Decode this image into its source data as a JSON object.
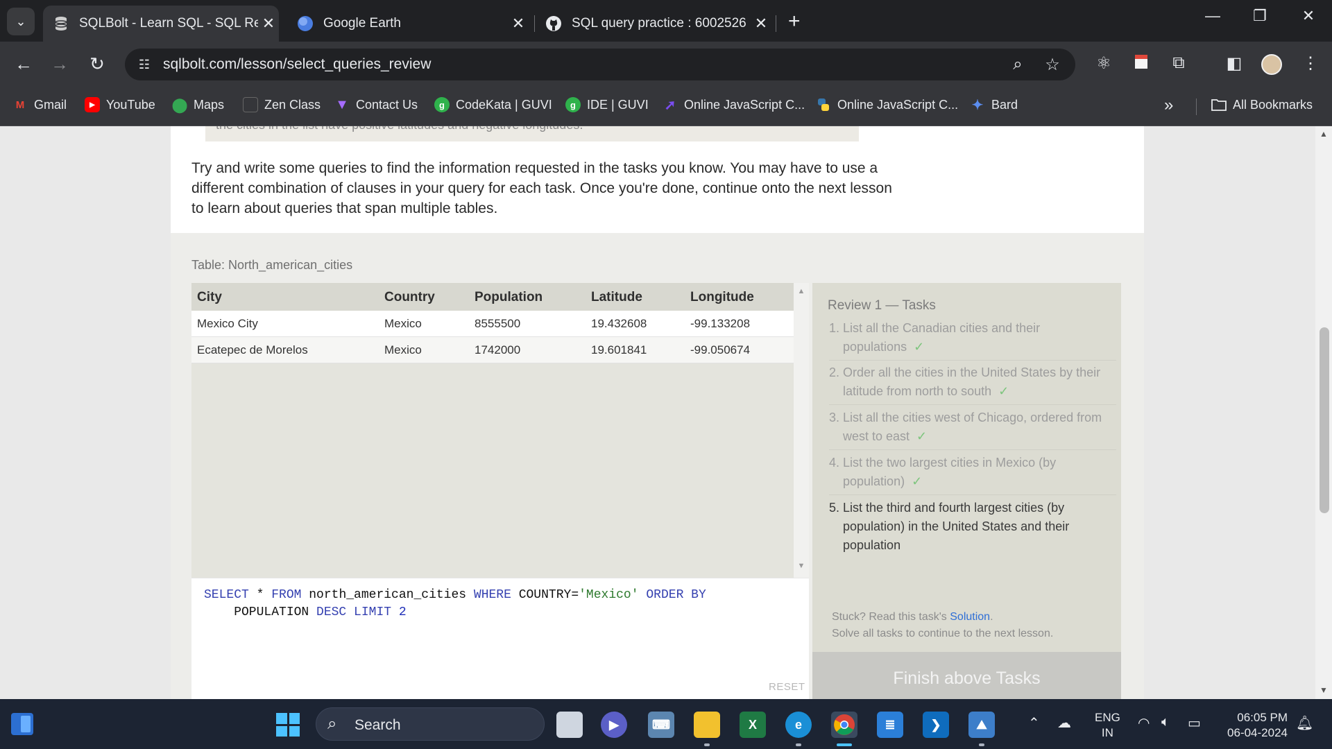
{
  "tabs": [
    {
      "title": "SQLBolt - Learn SQL - SQL Revi",
      "active": true
    },
    {
      "title": "Google Earth",
      "active": false
    },
    {
      "title": "SQL query practice : 6002526",
      "active": false
    }
  ],
  "url": "sqlbolt.com/lesson/select_queries_review",
  "bookmarks": [
    {
      "label": "Gmail",
      "icon": "gmail-icon"
    },
    {
      "label": "YouTube",
      "icon": "youtube-icon"
    },
    {
      "label": "Maps",
      "icon": "maps-icon"
    },
    {
      "label": "Zen Class",
      "icon": "zen-class-icon"
    },
    {
      "label": "Contact Us",
      "icon": "vite-icon"
    },
    {
      "label": "CodeKata | GUVI",
      "icon": "guvi-icon"
    },
    {
      "label": "IDE | GUVI",
      "icon": "guvi-icon"
    },
    {
      "label": "Online JavaScript C...",
      "icon": "js-compiler-icon"
    },
    {
      "label": "Online JavaScript C...",
      "icon": "python-icon"
    },
    {
      "label": "Bard",
      "icon": "bard-icon"
    }
  ],
  "all_bookmarks": "All Bookmarks",
  "lesson": {
    "hidden_line": "the cities in the list have positive latitudes and negative longitudes.",
    "intro": "Try and write some queries to find the information requested in the tasks you know. You may have to use a different combination of clauses in your query for each task. Once you're done, continue onto the next lesson to learn about queries that span multiple tables.",
    "table_caption": "Table: North_american_cities",
    "columns": [
      "City",
      "Country",
      "Population",
      "Latitude",
      "Longitude"
    ],
    "rows": [
      [
        "Mexico City",
        "Mexico",
        "8555500",
        "19.432608",
        "-99.133208"
      ],
      [
        "Ecatepec de Morelos",
        "Mexico",
        "1742000",
        "19.601841",
        "-99.050674"
      ]
    ],
    "query_line1": "SELECT * FROM north_american_cities WHERE COUNTRY='Mexico' ORDER BY",
    "query_line2": "    POPULATION DESC LIMIT 2",
    "reset": "RESET"
  },
  "tasks": {
    "title": "Review 1 — Tasks",
    "items": [
      {
        "num": "1.",
        "text": "List all the Canadian cities and their populations",
        "done": true
      },
      {
        "num": "2.",
        "text": "Order all the cities in the United States by their latitude from north to south",
        "done": true
      },
      {
        "num": "3.",
        "text": "List all the cities west of Chicago, ordered from west to east",
        "done": true
      },
      {
        "num": "4.",
        "text": "List the two largest cities in Mexico (by population)",
        "done": true
      },
      {
        "num": "5.",
        "text": "List the third and fourth largest cities (by population) in the United States and their population",
        "done": false
      }
    ],
    "check": "✓",
    "stuck_prefix": "Stuck? Read this task's ",
    "solution_link": "Solution",
    "stuck_suffix": ".",
    "solve_all": "Solve all tasks to continue to the next lesson.",
    "finish_button": "Finish above Tasks"
  },
  "taskbar": {
    "search": "Search",
    "lang_top": "ENG",
    "lang_bottom": "IN",
    "time": "06:05 PM",
    "date": "06-04-2024"
  }
}
